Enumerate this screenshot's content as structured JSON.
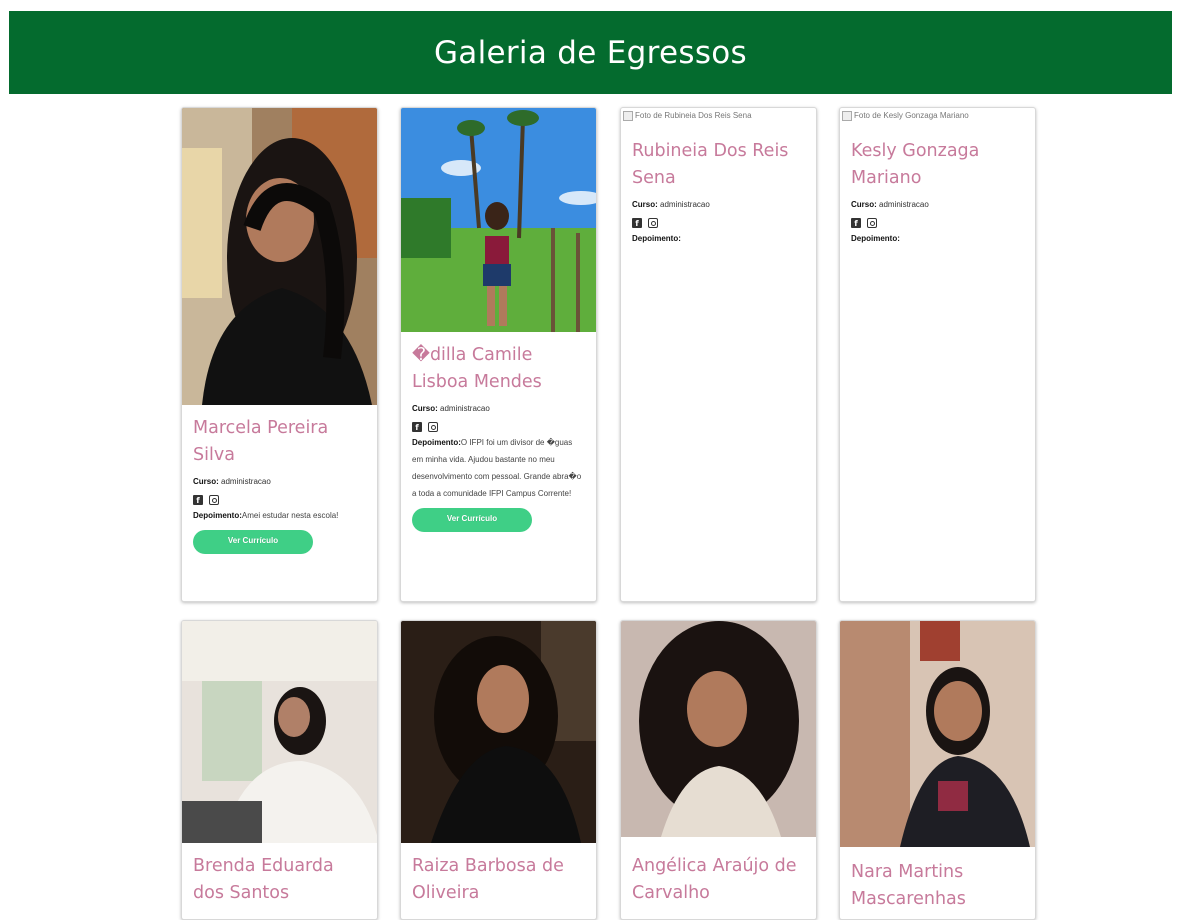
{
  "page": {
    "title": "Galeria de Egressos"
  },
  "labels": {
    "curso": "Curso:",
    "depoimento": "Depoimento:",
    "ver_curriculo": "Ver Currículo"
  },
  "colors": {
    "header_bg": "#046b2e",
    "name": "#c77a9b",
    "button": "#3fcf86"
  },
  "icons": [
    "facebook-icon",
    "instagram-icon",
    "broken-image-icon"
  ],
  "cards": [
    {
      "name": "Marcela Pereira Silva",
      "curso": "administracao",
      "depoimento": "Amei estudar nesta escola!"
    },
    {
      "name": "�dilla Camile Lisboa Mendes",
      "curso": "administracao",
      "depoimento": "O IFPI foi um divisor de �guas em minha vida. Ajudou bastante no meu desenvolvimento com pessoal. Grande abra�o a toda a comunidade IFPI Campus Corrente!"
    },
    {
      "name": "Rubineia Dos Reis Sena",
      "curso": "administracao",
      "depoimento": "",
      "photo_alt": "Foto de Rubineia Dos Reis Sena"
    },
    {
      "name": "Kesly Gonzaga Mariano",
      "curso": "administracao",
      "depoimento": "",
      "photo_alt": "Foto de Kesly Gonzaga Mariano"
    },
    {
      "name": "Brenda Eduarda dos Santos"
    },
    {
      "name": "Raiza Barbosa de Oliveira"
    },
    {
      "name": "Angélica Araújo de Carvalho"
    },
    {
      "name": "Nara Martins Mascarenhas"
    }
  ]
}
